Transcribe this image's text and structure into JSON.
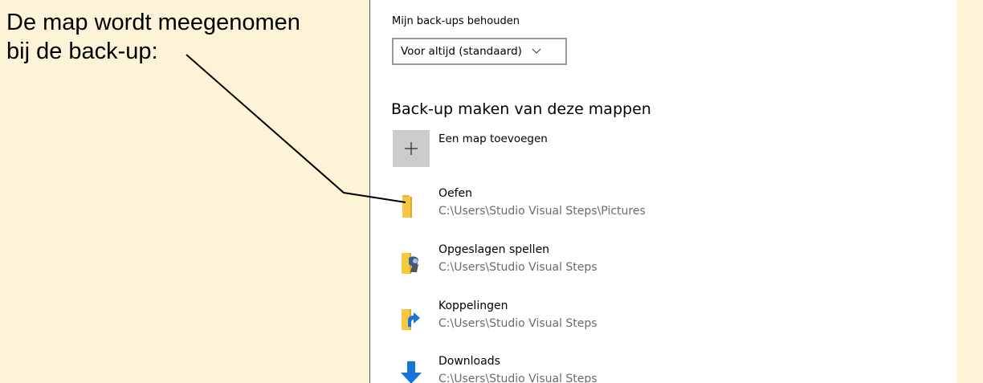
{
  "annotation": {
    "text": "De map wordt meegenomen\nbij de back-up:"
  },
  "settings": {
    "keep_label": "Mijn back-ups behouden",
    "keep_dropdown_value": "Voor altijd (standaard)",
    "section_title": "Back-up maken van deze mappen",
    "add_folder_label": "Een map toevoegen",
    "folders": [
      {
        "name": "Oefen",
        "path": "C:\\Users\\Studio Visual Steps\\Pictures",
        "icon": "folder-icon"
      },
      {
        "name": "Opgeslagen spellen",
        "path": "C:\\Users\\Studio Visual Steps",
        "icon": "saved-games-icon"
      },
      {
        "name": "Koppelingen",
        "path": "C:\\Users\\Studio Visual Steps",
        "icon": "links-folder-icon"
      },
      {
        "name": "Downloads",
        "path": "C:\\Users\\Studio Visual Steps",
        "icon": "downloads-icon"
      }
    ]
  },
  "colors": {
    "annotation_bg": "#fdf3d7",
    "panel_bg": "#ffffff",
    "add_tile": "#cccccc",
    "path_text": "#6b6b6b",
    "folder_yellow": "#f5c842",
    "download_blue": "#1a73d9"
  }
}
